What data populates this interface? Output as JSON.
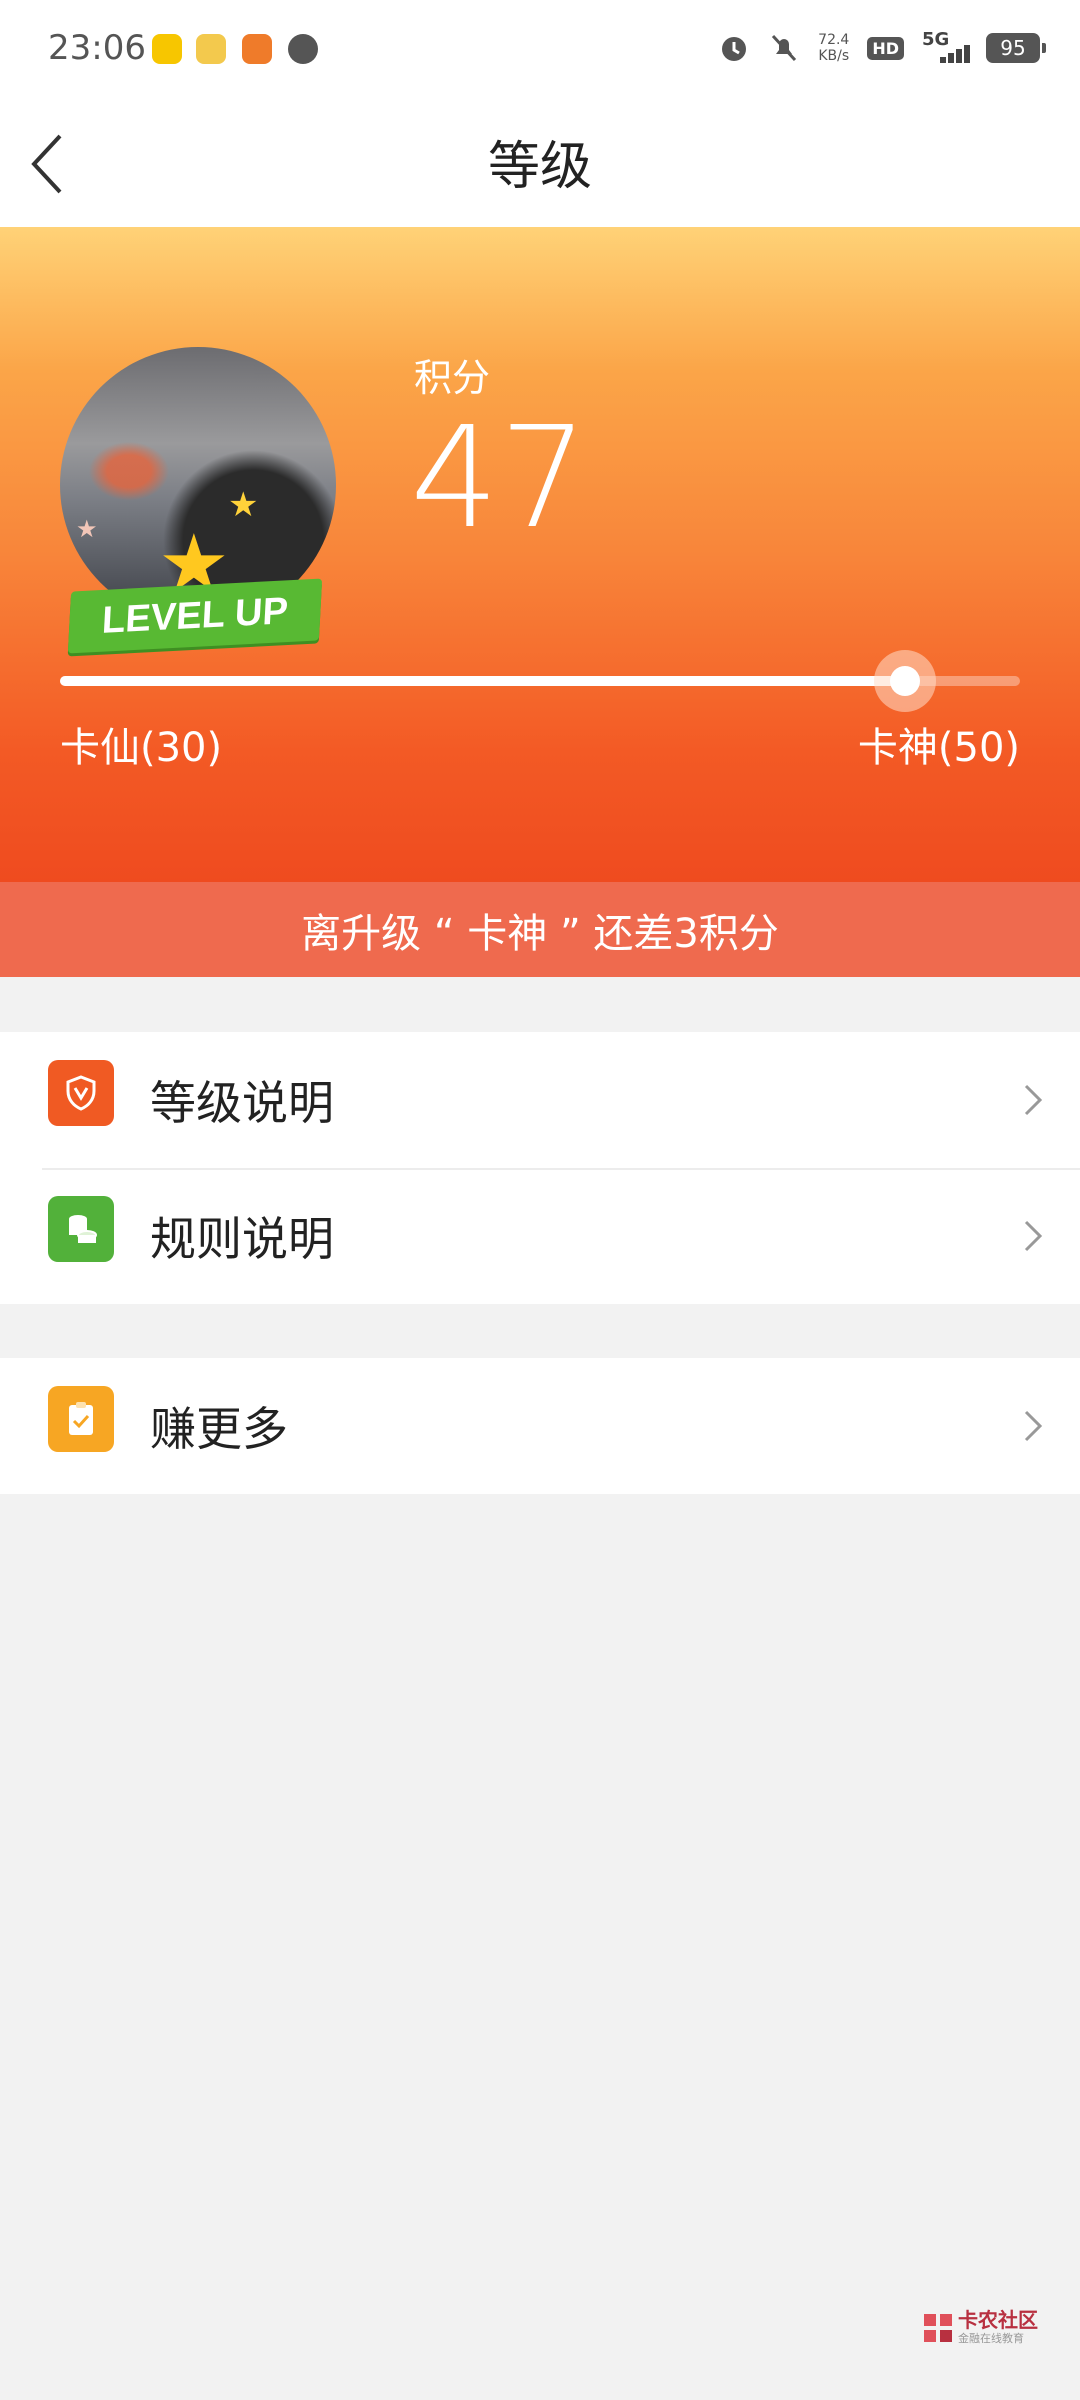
{
  "status_bar": {
    "time": "23:06",
    "network_speed_value": "72.4",
    "network_speed_unit": "KB/s",
    "hd_badge": "HD",
    "network_type": "5G",
    "battery": "95"
  },
  "header": {
    "title": "等级"
  },
  "hero": {
    "points_label": "积分",
    "points_value": "47",
    "badge_text": "LEVEL UP",
    "progress_fraction": 0.88,
    "level_left": "卡仙(30)",
    "level_right": "卡神(50)",
    "banner": "离升级 “ 卡神 ” 还差3积分"
  },
  "menu": {
    "group1": [
      {
        "label": "等级说明",
        "icon": "shield-v-icon",
        "color": "#f05a23"
      },
      {
        "label": "规则说明",
        "icon": "coins-icon",
        "color": "#52b13a"
      }
    ],
    "group2": [
      {
        "label": "赚更多",
        "icon": "clipboard-check-icon",
        "color": "#f7a623"
      }
    ]
  },
  "watermark": {
    "name": "卡农社区",
    "tagline": "金融在线教育"
  },
  "colors": {
    "hero_top": "#ffd277",
    "hero_bottom": "#ef4b1f",
    "banner": "#ef6a4e",
    "background": "#f2f2f2"
  }
}
